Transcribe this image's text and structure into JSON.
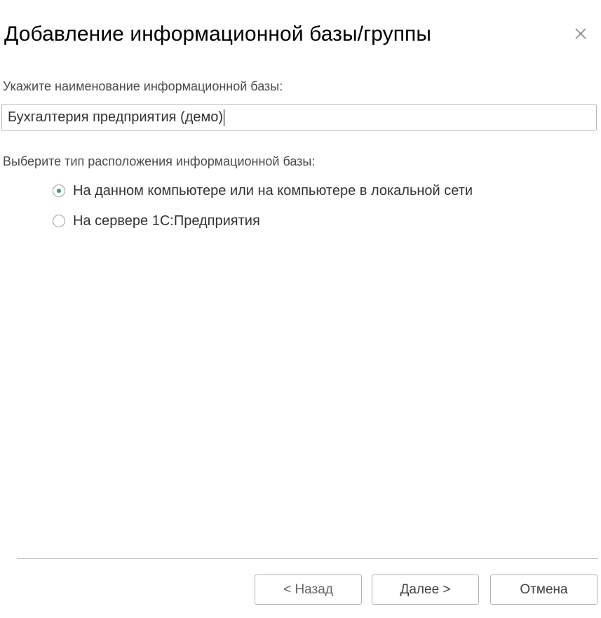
{
  "dialog": {
    "title": "Добавление информационной базы/группы",
    "close_icon": "close-icon"
  },
  "name_section": {
    "label": "Укажите наименование информационной базы:",
    "input_value": "Бухгалтерия предприятия (демо)"
  },
  "location_section": {
    "label": "Выберите тип расположения информационной базы:",
    "options": [
      {
        "label": "На данном компьютере или на компьютере в локальной сети",
        "selected": true
      },
      {
        "label": "На сервере 1С:Предприятия",
        "selected": false
      }
    ]
  },
  "footer": {
    "back_label": "< Назад",
    "next_label": "Далее >",
    "cancel_label": "Отмена"
  },
  "colors": {
    "radio_selected": "#2f9e6b",
    "border": "#b9b9b9"
  }
}
